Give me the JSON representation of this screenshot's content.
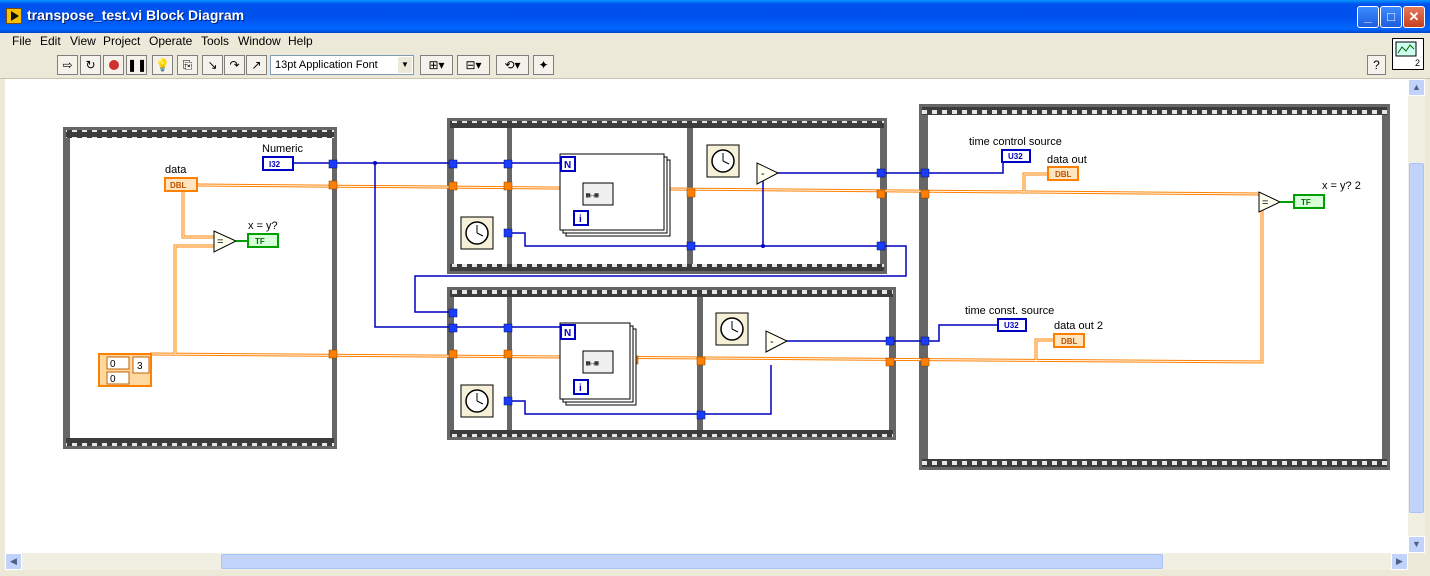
{
  "window": {
    "title": "transpose_test.vi Block Diagram",
    "controls": {
      "minimize": "_",
      "maximize": "□",
      "close": "✕"
    }
  },
  "menu": [
    "File",
    "Edit",
    "View",
    "Project",
    "Operate",
    "Tools",
    "Window",
    "Help"
  ],
  "toolbar": {
    "font": "13pt Application Font",
    "buttons": [
      "run-icon",
      "run-continuously-icon",
      "abort-icon",
      "pause-icon",
      "highlight-execution-icon",
      "retain-wire-values-icon",
      "step-into-icon",
      "step-over-icon",
      "step-out-icon",
      "align-icon",
      "distribute-icon",
      "reorder-icon",
      "cleanup-diagram-icon"
    ],
    "help": "?",
    "vi_icon_number": "2"
  },
  "diagram": {
    "labels": {
      "numeric": "Numeric",
      "data": "data",
      "xeqy": "x = y?",
      "time_control_source": "time control source",
      "data_out": "data out",
      "xeqy2": "x = y? 2",
      "time_const_source": "time const. source",
      "data_out_2": "data out 2"
    },
    "terminals": {
      "i32": "I32",
      "dbl": "DBL",
      "tf": "TF",
      "u32": "U32"
    },
    "constants": {
      "array_index_0": "0",
      "array_index_1": "0",
      "value_3": "3"
    },
    "for_loop": {
      "count": "N",
      "index": "i"
    },
    "subtract": "-",
    "equal": "="
  },
  "colors": {
    "orange_wire": "#ff8000",
    "blue_wire": "#0000c0",
    "green_bool": "#00a000",
    "frame": "#444444"
  }
}
